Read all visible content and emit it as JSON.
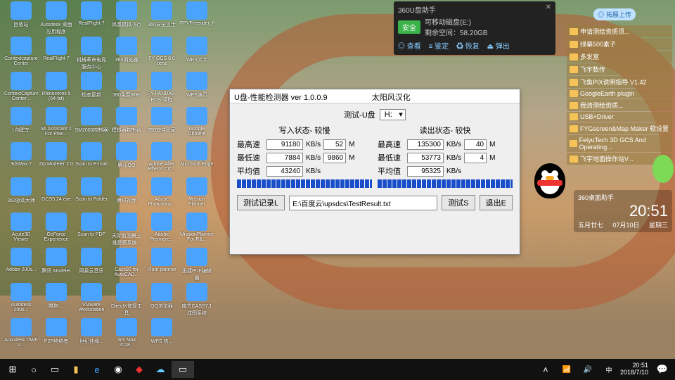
{
  "desktop_icons": [
    "回收站",
    "Autodesk 桌面应用程序",
    "RealFlight 7",
    "凤凰模拟飞行",
    "360安全卫士",
    "FPVFreerider_Recharged",
    "Contextcapture Center",
    "RealFlight 7",
    "机械革命电竞服务中心",
    "360浏览器",
    "FY GCS 6.0 beta",
    "WPS文字",
    "ContextCapture Center...",
    "Rhinoceros 5 (64-bit)",
    "检查更新",
    "360免费WiFi",
    "FY-PANDA2-POS-读取",
    "WPS演示",
    "I 创建车",
    "MI Assistant 2 For Plan...",
    "SM2000控制器",
    "模拟器控制台",
    "360软件管家",
    "Google Chrome",
    "3dsMax 7",
    "Dp Modeler 2.0",
    "Scan to E-mail",
    "腾讯QQ",
    "Adobe After Effects CC...",
    "Microsoft Edge",
    "360驱动大师",
    "GCS5.24.exe",
    "Scan to Folder",
    "腾讯视频",
    "Adobe Photoshop...",
    "Mission Planner",
    "Acute3D Viewer",
    "GeForce Experience",
    "Scan to PDF",
    "天际航测景三维建模系统...",
    "Adobe Premiere...",
    "MissionPlanner For R&...",
    "Adobe 200s...",
    "腾讯 Modeler",
    "网易云音乐",
    "Cass90 for AutoCAD...",
    "Plum planner",
    "迅捷PDF编辑器",
    "Autodesk 200s...",
    "酷狗 ...",
    "VMware Workstation",
    "DirectX修复工具",
    "QQ浏览器",
    "南方CASS7.1 成图系统",
    "Autodesk DWF V...",
    "P2P终结者",
    "世纪佳缘...",
    "3ds Max 2018...",
    "WPS 热..."
  ],
  "pin_label": "◎ 拓展上传",
  "usb_widget": {
    "title": "360U盘助手",
    "badge": "安全",
    "line1": "可移动磁盘(E:)",
    "line2": "剩余空间：58.20GB",
    "links": [
      "◎ 查看",
      "≡ 鉴定",
      "♻ 恢复",
      "⏏ 弹出"
    ]
  },
  "dialog": {
    "title_left": "U盘-性能检测器  ver 1.0.0.9",
    "title_right": "太阳风汉化",
    "test_label": "测试-U盘",
    "drive": "H:",
    "write_header": "写入状态- 较慢",
    "read_header": "读出状态- 较快",
    "rows": {
      "max": "最高速",
      "min": "最低速",
      "avg": "平均值"
    },
    "unit": "KB/s",
    "munit": "M",
    "write": {
      "max": "91180",
      "max_m": "52",
      "min": "7884",
      "min_m": "9860",
      "avg": "43240"
    },
    "read": {
      "max": "135300",
      "max_m": "40",
      "min": "53773",
      "min_m": "4",
      "avg": "95325"
    },
    "record_btn": "测试记录L",
    "record_path": "E:\\百度云\\upsdcs\\TestResult.txt",
    "test_btn": "测试S",
    "exit_btn": "退出E"
  },
  "files": [
    "申请测绘资质须...",
    "绿幕500素子",
    "多发富",
    "飞宇数传",
    "飞鱼PIX说明指导 V1.42",
    "GoogleEarth plugin",
    "我清测绘资质...",
    "USB+Driver",
    "FYGscreen&Map Maker 软设置",
    "FeiyuTech 3D GCS And Operating...",
    "飞宇地面操作站V..."
  ],
  "clock": {
    "time": "20:51",
    "lunar": "五月廿七",
    "date": "07月10日",
    "weekday": "星期三",
    "city": "360桌面助手"
  },
  "taskbar": {
    "tray_time": "20:51",
    "tray_date": "2018/7/10"
  }
}
